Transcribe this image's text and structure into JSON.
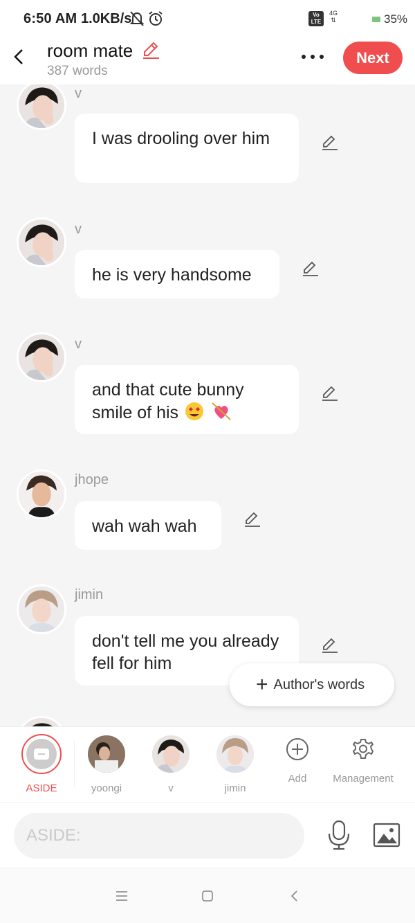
{
  "status_bar": {
    "time": "6:50 AM",
    "net_speed": "1.0KB/s",
    "network": "4G",
    "lte": "Vo LTE",
    "battery": "35%"
  },
  "header": {
    "title": "room mate",
    "word_count": "387 words",
    "next_label": "Next"
  },
  "messages": [
    {
      "sender": "v",
      "text": "I was drooling over him"
    },
    {
      "sender": "v",
      "text": "he is very handsome"
    },
    {
      "sender": "v",
      "text": "and that cute bunny smile of his",
      "emojis": [
        "heart-eyes-emoji",
        "heart-arrow-emoji"
      ]
    },
    {
      "sender": "jhope",
      "text": "wah wah wah"
    },
    {
      "sender": "jimin",
      "text": "don't tell me you already fell for him"
    }
  ],
  "author_words_label": "Author's words",
  "characters": [
    {
      "label": "ASIDE",
      "selected": true
    },
    {
      "label": "yoongi"
    },
    {
      "label": "v"
    },
    {
      "label": "jimin"
    },
    {
      "label": "Add"
    },
    {
      "label": "Management"
    }
  ],
  "input": {
    "placeholder": "ASIDE:"
  },
  "colors": {
    "accent": "#f04e4e",
    "background": "#f5f5f5",
    "bubble": "#ffffff"
  }
}
